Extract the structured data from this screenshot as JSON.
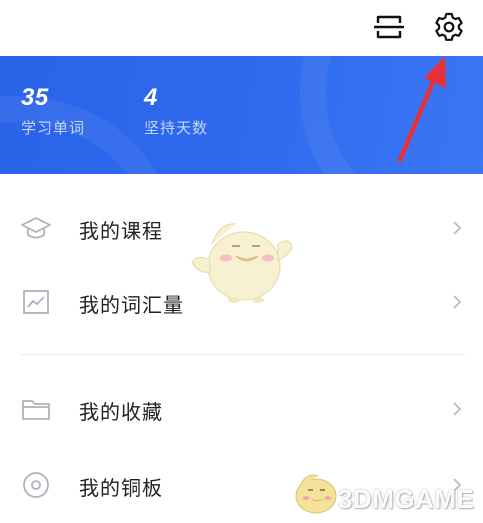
{
  "header": {
    "scan_icon": "scan-icon",
    "settings_icon": "gear-icon"
  },
  "stats": [
    {
      "value": "35",
      "label": "学习单词"
    },
    {
      "value": "4",
      "label": "坚持天数"
    }
  ],
  "menu": [
    {
      "label": "我的课程",
      "icon": "graduation-cap-icon"
    },
    {
      "label": "我的词汇量",
      "icon": "chart-icon"
    },
    {
      "label": "我的收藏",
      "icon": "folder-icon"
    },
    {
      "label": "我的铜板",
      "icon": "coin-icon"
    }
  ],
  "colors": {
    "banner": "#2f6bef",
    "arrow": "#e8303a",
    "icon": "#aeb3bb"
  },
  "watermark": {
    "text": "3DMGAME"
  }
}
